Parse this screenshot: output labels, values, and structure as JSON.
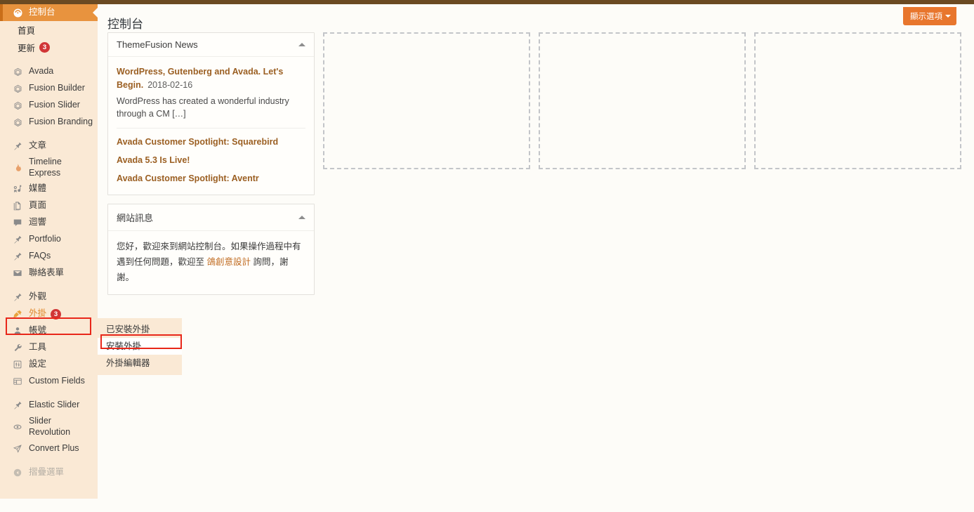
{
  "adminbar": {
    "present": true,
    "color": "#6b4a22"
  },
  "header": {
    "page_title": "控制台",
    "screen_options_label": "顯示選項"
  },
  "sidebar": {
    "active_item": "控制台",
    "items": [
      {
        "label": "控制台",
        "icon": "dashboard-icon",
        "active": true
      },
      {
        "label": "首頁",
        "icon": "",
        "sub": true
      },
      {
        "label": "更新",
        "icon": "",
        "sub": true,
        "badge": "3"
      },
      {
        "label": "Avada",
        "icon": "avada-hex-icon"
      },
      {
        "label": "Fusion Builder",
        "icon": "avada-hex-icon"
      },
      {
        "label": "Fusion Slider",
        "icon": "avada-hex-icon"
      },
      {
        "label": "Fusion Branding",
        "icon": "avada-hex-icon"
      },
      {
        "label": "文章",
        "icon": "pin-icon"
      },
      {
        "label": "Timeline Express",
        "icon": "flame-icon"
      },
      {
        "label": "媒體",
        "icon": "media-icon"
      },
      {
        "label": "頁面",
        "icon": "page-icon"
      },
      {
        "label": "迴響",
        "icon": "comment-icon"
      },
      {
        "label": "Portfolio",
        "icon": "pin-icon"
      },
      {
        "label": "FAQs",
        "icon": "pin-icon"
      },
      {
        "label": "聯絡表單",
        "icon": "envelope-icon"
      },
      {
        "label": "外觀",
        "icon": "brush-icon"
      },
      {
        "label": "外掛",
        "icon": "plug-icon",
        "badge": "3",
        "hovered": true
      },
      {
        "label": "帳號",
        "icon": "user-icon"
      },
      {
        "label": "工具",
        "icon": "wrench-icon"
      },
      {
        "label": "設定",
        "icon": "settings-icon"
      },
      {
        "label": "Custom Fields",
        "icon": "fields-icon"
      },
      {
        "label": "Elastic Slider",
        "icon": "pin-icon"
      },
      {
        "label": "Slider Revolution",
        "icon": "revolution-icon"
      },
      {
        "label": "Convert Plus",
        "icon": "convert-icon"
      },
      {
        "label": "摺疊選單",
        "icon": "collapse-icon",
        "dim": true
      }
    ]
  },
  "flyout": {
    "parent": "外掛",
    "items": [
      {
        "label": "已安裝外掛",
        "current": false
      },
      {
        "label": "安裝外掛",
        "current": true
      },
      {
        "label": "外掛編輯器",
        "current": false
      }
    ]
  },
  "annotations": {
    "highlight_color": "#e8271a",
    "boxes": [
      {
        "target": "sidebar-item-plugins"
      },
      {
        "target": "flyout-item-add-plugin"
      }
    ]
  },
  "widgets": {
    "news": {
      "title": "ThemeFusion News",
      "items": [
        {
          "title": "WordPress, Gutenberg and Avada. Let's Begin.",
          "date": "2018-02-16",
          "summary": "WordPress has created a wonderful industry through a CM […]"
        },
        {
          "title": "Avada Customer Spotlight: Squarebird",
          "date": "",
          "summary": ""
        },
        {
          "title": "Avada 5.3 Is Live!",
          "date": "",
          "summary": ""
        },
        {
          "title": "Avada Customer Spotlight: Aventr",
          "date": "",
          "summary": ""
        }
      ]
    },
    "site_message": {
      "title": "網站訊息",
      "text_before": "您好，歡迎來到網站控制台。如果操作過程中有遇到任何問題，歡迎至 ",
      "link_text": "鴿創意設計",
      "text_after": " 詢問，謝謝。"
    },
    "placeholders": [
      {
        "name": "widget-dropzone-2"
      },
      {
        "name": "widget-dropzone-3"
      },
      {
        "name": "widget-dropzone-4"
      }
    ]
  }
}
